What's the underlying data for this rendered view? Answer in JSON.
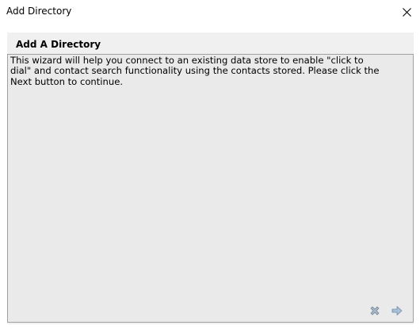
{
  "window": {
    "title": "Add Directory"
  },
  "wizard": {
    "header_title": "Add A Directory",
    "description": "This wizard will help you connect to an existing data store to enable \"click to\ndial\" and contact search functionality using the contacts stored.  Please click the\nNext button to continue."
  },
  "navigation": {
    "cancel_icon": "cancel-x-icon",
    "next_icon": "arrow-right-icon"
  },
  "colors": {
    "panel_background": "#eaeaea",
    "client_background": "#f0f0f0",
    "panel_border": "#a0a0a0",
    "icon_gray_blue": "#8aa0b4"
  }
}
